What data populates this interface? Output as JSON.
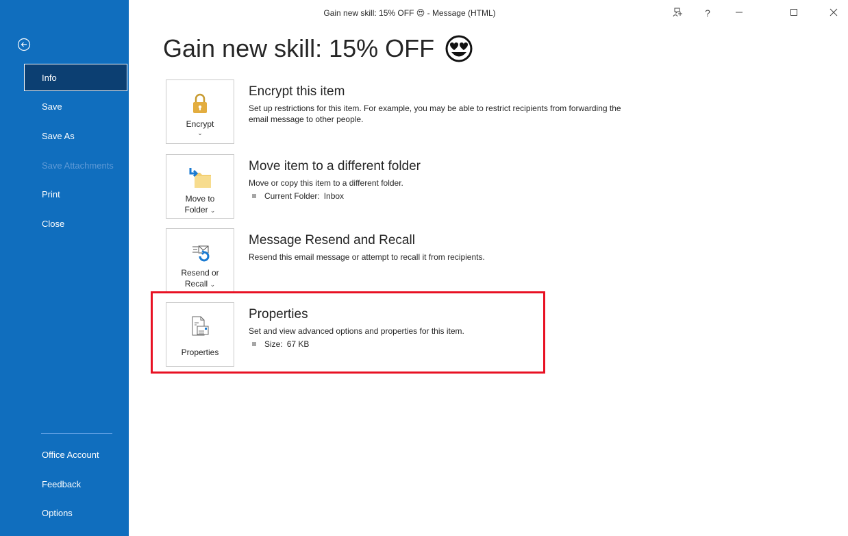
{
  "window": {
    "title": "Gain new skill: 15% OFF",
    "title_emoji": "😍",
    "title_suffix": "- Message (HTML)"
  },
  "sidebar": {
    "back_icon": "back-arrow-circle-icon",
    "items": [
      {
        "label": "Info",
        "selected": true
      },
      {
        "label": "Save"
      },
      {
        "label": "Save As"
      },
      {
        "label": "Save Attachments",
        "disabled": true
      },
      {
        "label": "Print"
      },
      {
        "label": "Close"
      }
    ],
    "footer_items": [
      {
        "label": "Office Account"
      },
      {
        "label": "Feedback"
      },
      {
        "label": "Options"
      }
    ]
  },
  "page": {
    "title": "Gain new skill: 15% OFF",
    "title_emoji_icon": "heart-eyes-emoji-icon"
  },
  "sections": [
    {
      "button_label": "Encrypt",
      "button_chevron": "⌄",
      "icon": "padlock-icon",
      "heading": "Encrypt this item",
      "description": "Set up restrictions for this item. For example, you may be able to restrict recipients from forwarding the email message to other people."
    },
    {
      "button_label_line1": "Move to",
      "button_label_line2": "Folder",
      "icon": "move-to-folder-icon",
      "heading": "Move item to a different folder",
      "description": "Move or copy this item to a different folder.",
      "sub_label": "Current Folder:",
      "sub_value": "Inbox"
    },
    {
      "button_label_line1": "Resend or",
      "button_label_line2": "Recall",
      "icon": "resend-recall-icon",
      "heading": "Message Resend and Recall",
      "description": "Resend this email message or attempt to recall it from recipients."
    },
    {
      "button_label": "Properties",
      "icon": "properties-document-icon",
      "heading": "Properties",
      "description": "Set and view advanced options and properties for this item.",
      "sub_label": "Size:",
      "sub_value": "67 KB"
    }
  ],
  "colors": {
    "sidebar_bg": "#106ebe",
    "sidebar_selected_bg": "#0c3f72",
    "highlight": "#e81123"
  }
}
